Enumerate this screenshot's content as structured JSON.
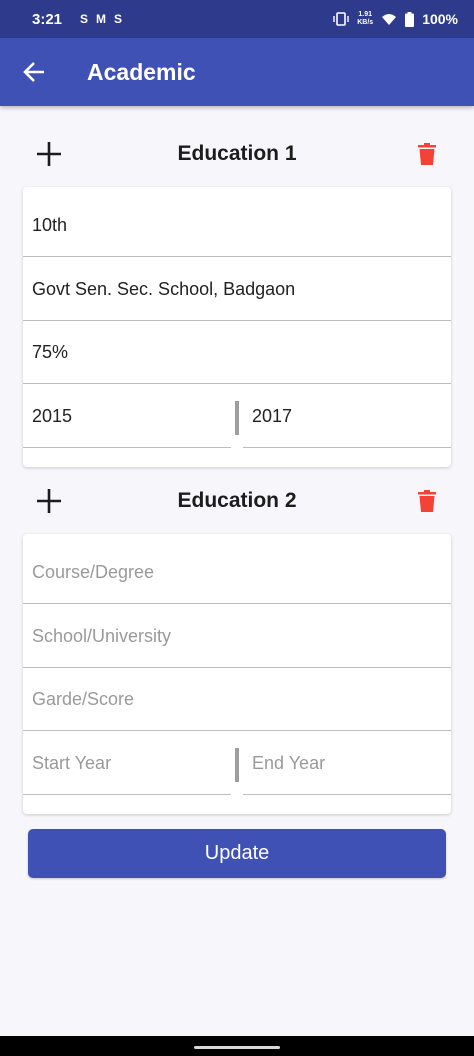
{
  "status_bar": {
    "time": "3:21",
    "left_icons": [
      "S",
      "M",
      "S"
    ],
    "net_speed_value": "1.91",
    "net_speed_unit": "KB/s",
    "battery": "100%"
  },
  "app_bar": {
    "title": "Academic"
  },
  "educations": [
    {
      "title": "Education 1",
      "course": {
        "value": "10th",
        "placeholder": "Course/Degree"
      },
      "school": {
        "value": "Govt Sen. Sec. School, Badgaon",
        "placeholder": "School/University"
      },
      "grade": {
        "value": "75%",
        "placeholder": "Garde/Score"
      },
      "start_year": {
        "value": "2015",
        "placeholder": "Start Year"
      },
      "end_year": {
        "value": "2017",
        "placeholder": "End Year"
      }
    },
    {
      "title": "Education 2",
      "course": {
        "value": "",
        "placeholder": "Course/Degree"
      },
      "school": {
        "value": "",
        "placeholder": "School/University"
      },
      "grade": {
        "value": "",
        "placeholder": "Garde/Score"
      },
      "start_year": {
        "value": "",
        "placeholder": "Start Year"
      },
      "end_year": {
        "value": "",
        "placeholder": "End Year"
      }
    }
  ],
  "update_button": {
    "label": "Update"
  },
  "colors": {
    "primary": "#3f51b5",
    "status_bar": "#2e3a8c",
    "delete": "#f44336",
    "background": "#f7f6fb"
  }
}
